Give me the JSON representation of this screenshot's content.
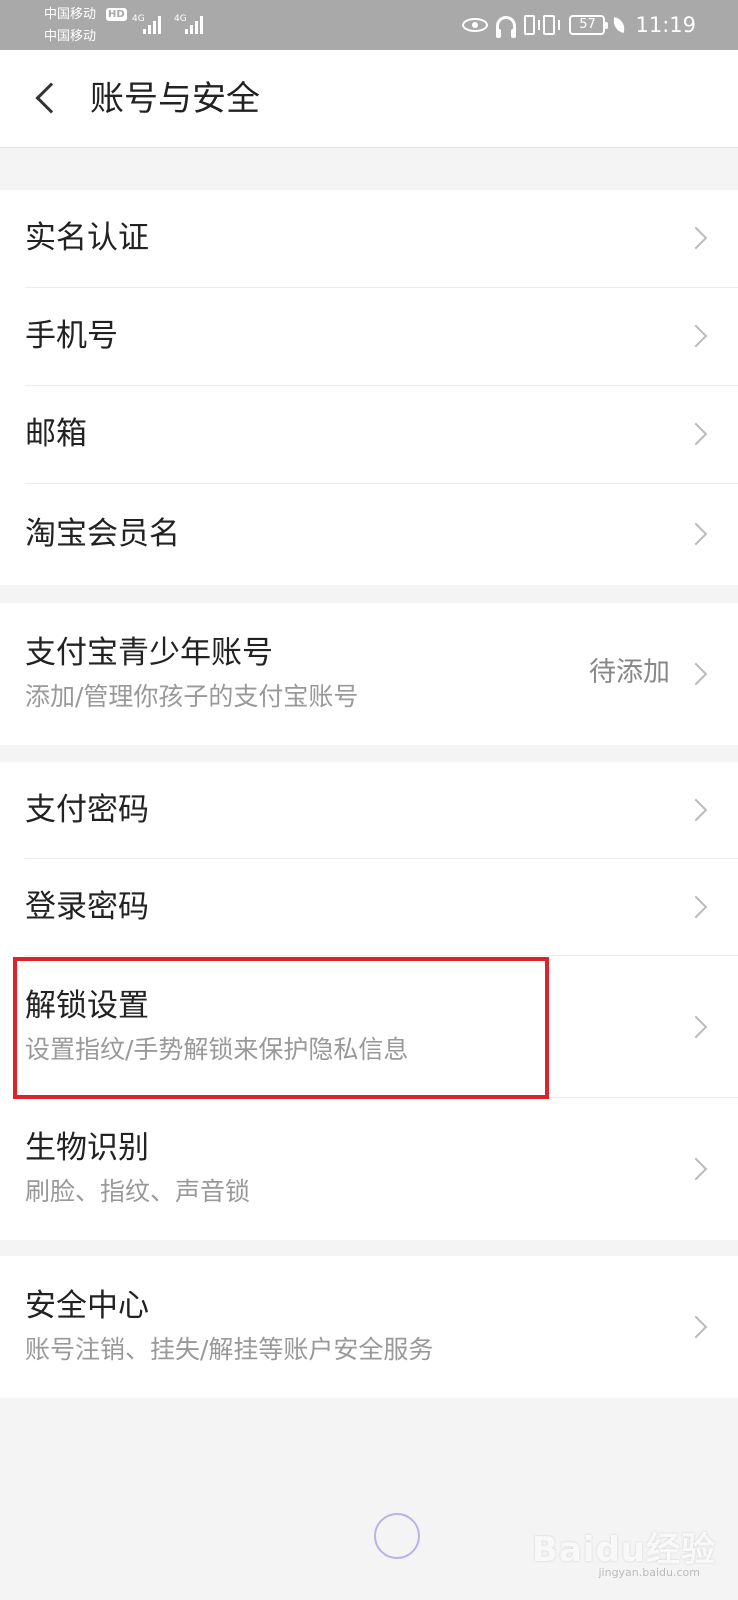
{
  "status_bar": {
    "carrier1": "中国移动",
    "carrier2": "中国移动",
    "hd": "HD",
    "network1": "4G",
    "network2": "4G",
    "battery_level": "57",
    "time": "11:19"
  },
  "header": {
    "title": "账号与安全"
  },
  "groups": [
    {
      "items": [
        {
          "title": "实名认证"
        },
        {
          "title": "手机号"
        },
        {
          "title": "邮箱"
        },
        {
          "title": "淘宝会员名"
        }
      ]
    },
    {
      "items": [
        {
          "title": "支付宝青少年账号",
          "subtitle": "添加/管理你孩子的支付宝账号",
          "value": "待添加"
        }
      ]
    },
    {
      "items": [
        {
          "title": "支付密码"
        },
        {
          "title": "登录密码"
        },
        {
          "title": "解锁设置",
          "subtitle": "设置指纹/手势解锁来保护隐私信息"
        },
        {
          "title": "生物识别",
          "subtitle": "刷脸、指纹、声音锁"
        }
      ]
    },
    {
      "items": [
        {
          "title": "安全中心",
          "subtitle": "账号注销、挂失/解挂等账户安全服务"
        }
      ]
    }
  ],
  "watermark": {
    "brand": "Baidu经验",
    "url": "jingyan.baidu.com"
  }
}
